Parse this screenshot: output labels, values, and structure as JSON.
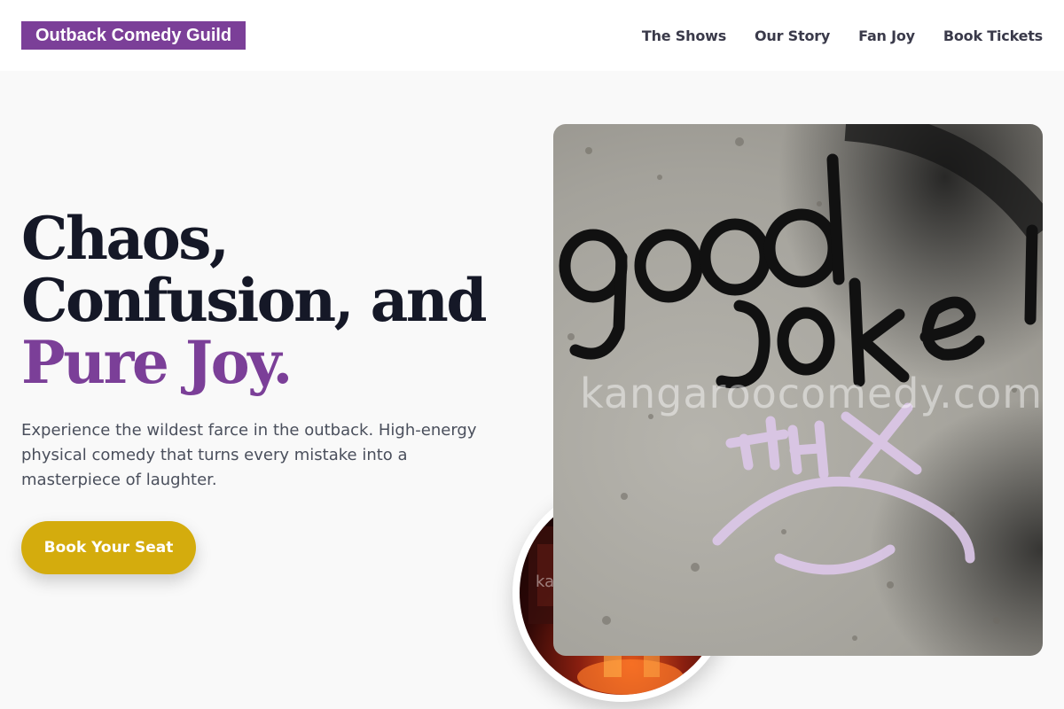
{
  "header": {
    "brand": "Outback Comedy Guild",
    "nav": [
      "The Shows",
      "Our Story",
      "Fan Joy",
      "Book Tickets"
    ]
  },
  "hero": {
    "title_line1": "Chaos,",
    "title_line2": "Confusion, and",
    "title_accent": "Pure Joy.",
    "description": "Experience the wildest farce in the outback. High-energy physical comedy that turns every mistake into a masterpiece of laughter.",
    "cta_label": "Book Your Seat"
  },
  "images": {
    "main_watermark": "kangaroocomedy.com",
    "main_graffiti": [
      "good",
      "joke",
      "THX"
    ],
    "circle_watermark": "ka"
  },
  "colors": {
    "brand": "#7b3f98",
    "cta": "#d4ac0d",
    "heading": "#151827",
    "body_text": "#4a4f5c"
  }
}
